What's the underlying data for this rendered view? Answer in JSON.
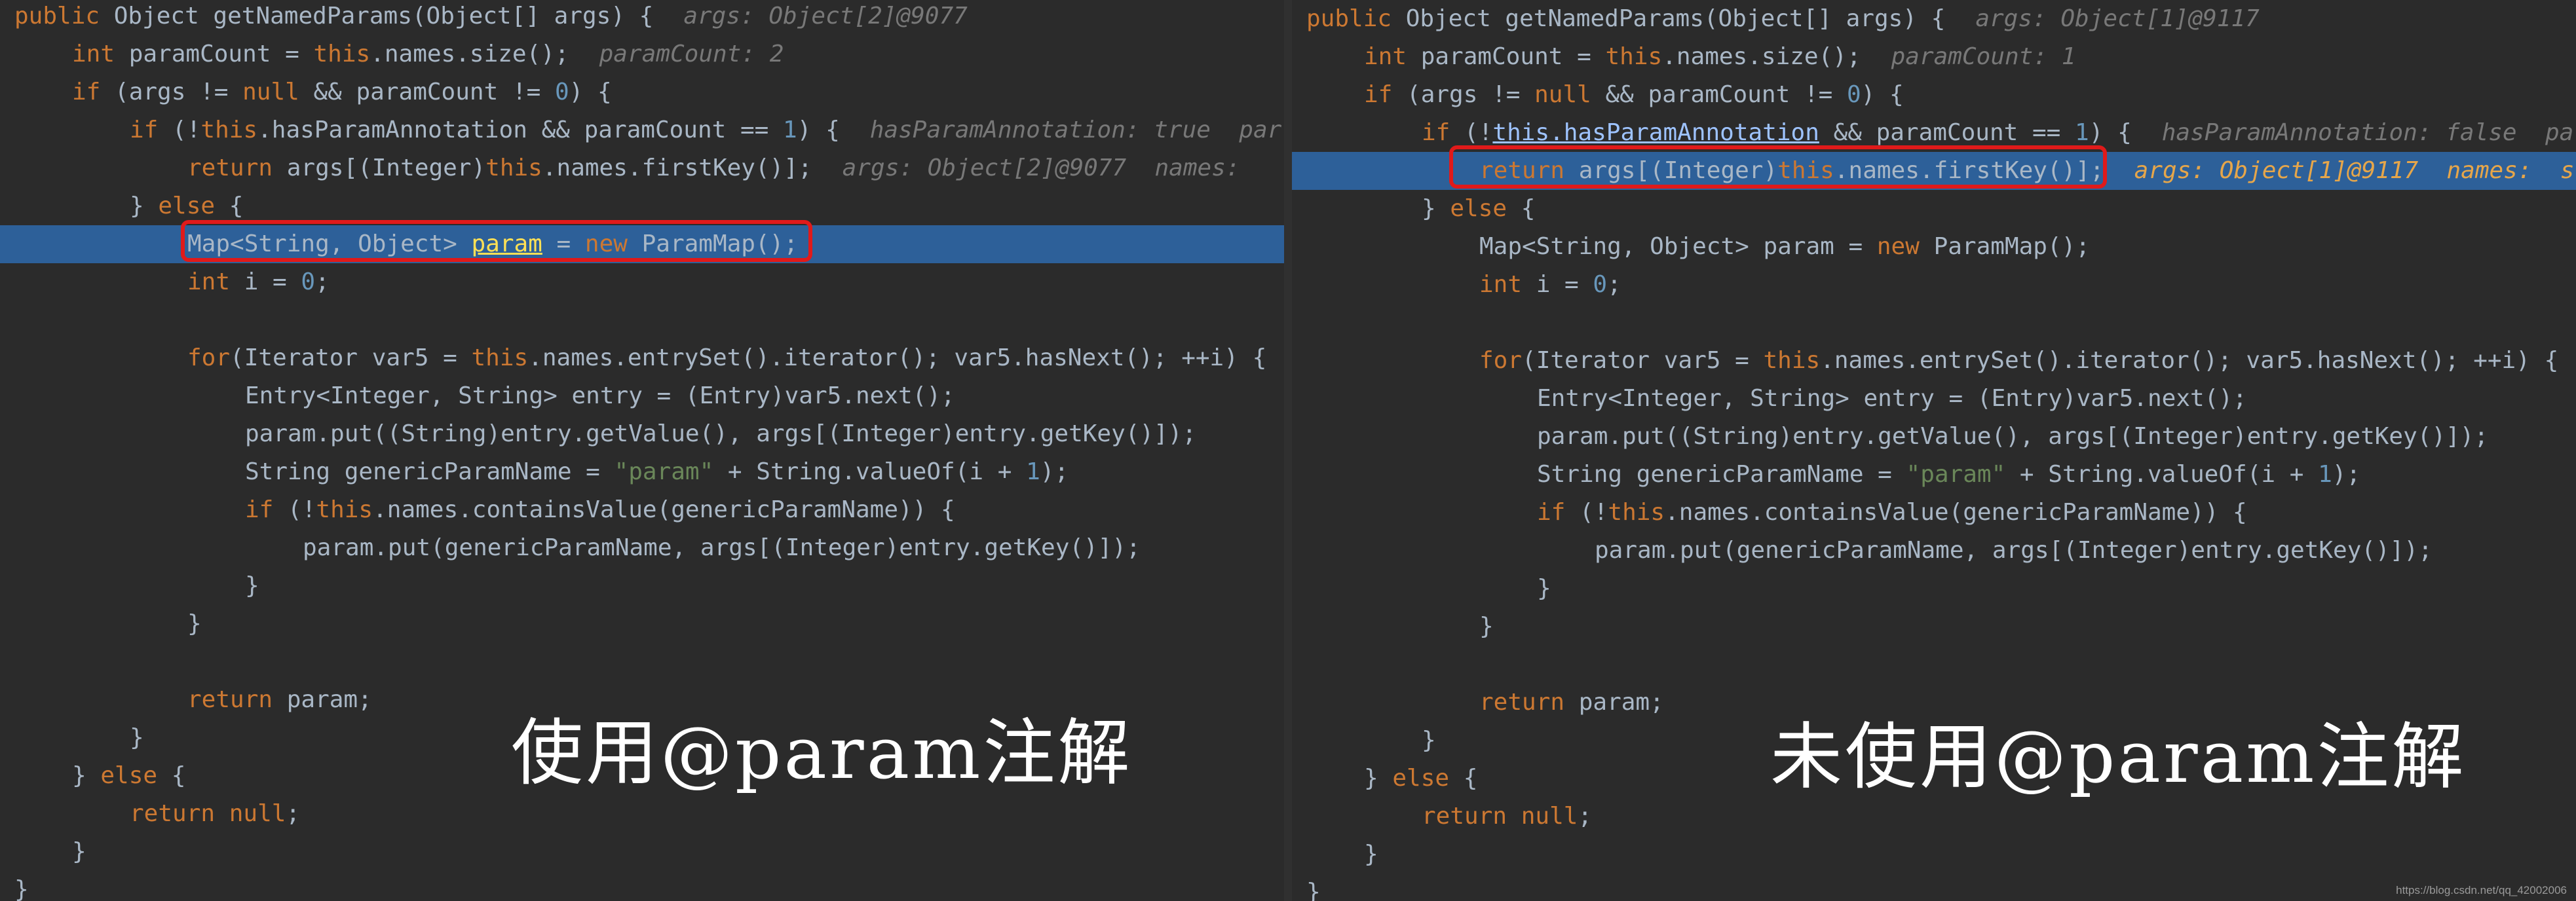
{
  "left": {
    "lines": [
      {
        "indent": 0,
        "parts": [
          [
            "kw",
            "public "
          ],
          [
            "p",
            "Object getNamedParams(Object[] args) {"
          ],
          [
            "hint",
            "args: Object[2]@9077"
          ]
        ]
      },
      {
        "indent": 1,
        "parts": [
          [
            "kw",
            "int "
          ],
          [
            "p",
            "paramCount = "
          ],
          [
            "this",
            "this"
          ],
          [
            "p",
            ".names.size();"
          ],
          [
            "hint",
            "paramCount: 2"
          ]
        ]
      },
      {
        "indent": 1,
        "parts": [
          [
            "kw",
            "if "
          ],
          [
            "p",
            "(args != "
          ],
          [
            "kw",
            "null "
          ],
          [
            "p",
            "&& paramCount != "
          ],
          [
            "num",
            "0"
          ],
          [
            "p",
            ") {"
          ]
        ]
      },
      {
        "indent": 2,
        "parts": [
          [
            "kw",
            "if "
          ],
          [
            "p",
            "(!"
          ],
          [
            "this",
            "this"
          ],
          [
            "p",
            ".hasParamAnnotation && paramCount == "
          ],
          [
            "num",
            "1"
          ],
          [
            "p",
            ") {"
          ],
          [
            "hint",
            "hasParamAnnotation: true  par"
          ]
        ]
      },
      {
        "indent": 3,
        "parts": [
          [
            "kw",
            "return "
          ],
          [
            "p",
            "args[(Integer)"
          ],
          [
            "this",
            "this"
          ],
          [
            "p",
            ".names.firstKey()];"
          ],
          [
            "hint",
            "args: Object[2]@9077  names: "
          ]
        ]
      },
      {
        "indent": 2,
        "parts": [
          [
            "p",
            "} "
          ],
          [
            "kw",
            "else "
          ],
          [
            "p",
            "{"
          ]
        ]
      },
      {
        "indent": 3,
        "hl": true,
        "parts": [
          [
            "p",
            "Map<String, Object> "
          ],
          [
            "uly",
            "param"
          ],
          [
            "p",
            " = "
          ],
          [
            "kw",
            "new "
          ],
          [
            "p",
            "ParamMap();"
          ]
        ]
      },
      {
        "indent": 3,
        "parts": [
          [
            "kw",
            "int "
          ],
          [
            "p",
            "i = "
          ],
          [
            "num",
            "0"
          ],
          [
            "p",
            ";"
          ]
        ]
      },
      {
        "indent": 0,
        "parts": []
      },
      {
        "indent": 3,
        "parts": [
          [
            "kw",
            "for"
          ],
          [
            "p",
            "(Iterator var5 = "
          ],
          [
            "this",
            "this"
          ],
          [
            "p",
            ".names.entrySet().iterator(); var5.hasNext(); ++i) {"
          ]
        ]
      },
      {
        "indent": 4,
        "parts": [
          [
            "p",
            "Entry<Integer, String> entry = (Entry)var5.next();"
          ]
        ]
      },
      {
        "indent": 4,
        "parts": [
          [
            "p",
            "param.put((String)entry.getValue(), args[(Integer)entry.getKey()]);"
          ]
        ]
      },
      {
        "indent": 4,
        "parts": [
          [
            "p",
            "String genericParamName = "
          ],
          [
            "str",
            "\"param\""
          ],
          [
            "p",
            " + String.valueOf(i + "
          ],
          [
            "num",
            "1"
          ],
          [
            "p",
            ");"
          ]
        ]
      },
      {
        "indent": 4,
        "parts": [
          [
            "kw",
            "if "
          ],
          [
            "p",
            "(!"
          ],
          [
            "this",
            "this"
          ],
          [
            "p",
            ".names.containsValue(genericParamName)) {"
          ]
        ]
      },
      {
        "indent": 5,
        "parts": [
          [
            "p",
            "param.put(genericParamName, args[(Integer)entry.getKey()]);"
          ]
        ]
      },
      {
        "indent": 4,
        "parts": [
          [
            "p",
            "}"
          ]
        ]
      },
      {
        "indent": 3,
        "parts": [
          [
            "p",
            "}"
          ]
        ]
      },
      {
        "indent": 0,
        "parts": []
      },
      {
        "indent": 3,
        "parts": [
          [
            "kw",
            "return "
          ],
          [
            "p",
            "param;"
          ]
        ]
      },
      {
        "indent": 2,
        "parts": [
          [
            "p",
            "}"
          ]
        ]
      },
      {
        "indent": 1,
        "parts": [
          [
            "p",
            "} "
          ],
          [
            "kw",
            "else "
          ],
          [
            "p",
            "{"
          ]
        ]
      },
      {
        "indent": 2,
        "parts": [
          [
            "kw",
            "return null"
          ],
          [
            "p",
            ";"
          ]
        ]
      },
      {
        "indent": 1,
        "parts": [
          [
            "p",
            "}"
          ]
        ]
      },
      {
        "indent": 0,
        "parts": [
          [
            "p",
            "}"
          ]
        ]
      }
    ],
    "caption": "使用@param注解"
  },
  "right": {
    "lines": [
      {
        "indent": 0,
        "parts": [
          [
            "kw",
            "public "
          ],
          [
            "p",
            "Object getNamedParams(Object[] args) {"
          ],
          [
            "hint",
            "args: Object[1]@9117"
          ]
        ]
      },
      {
        "indent": 1,
        "parts": [
          [
            "kw",
            "int "
          ],
          [
            "p",
            "paramCount = "
          ],
          [
            "this",
            "this"
          ],
          [
            "p",
            ".names.size();"
          ],
          [
            "hint",
            "paramCount: 1"
          ]
        ]
      },
      {
        "indent": 1,
        "parts": [
          [
            "kw",
            "if "
          ],
          [
            "p",
            "(args != "
          ],
          [
            "kw",
            "null "
          ],
          [
            "p",
            "&& paramCount != "
          ],
          [
            "num",
            "0"
          ],
          [
            "p",
            ") {"
          ]
        ]
      },
      {
        "indent": 2,
        "parts": [
          [
            "kw",
            "if "
          ],
          [
            "p",
            "(!"
          ],
          [
            "ulb",
            "this.hasParamAnnotation"
          ],
          [
            "p",
            " && paramCount == "
          ],
          [
            "num",
            "1"
          ],
          [
            "p",
            ") {"
          ],
          [
            "hint",
            "hasParamAnnotation: false  pa"
          ]
        ]
      },
      {
        "indent": 3,
        "hl": true,
        "parts": [
          [
            "kw",
            "return "
          ],
          [
            "p",
            "args[(Integer)"
          ],
          [
            "this",
            "this"
          ],
          [
            "p",
            ".names.firstKey()];"
          ],
          [
            "hinto",
            "args: Object[1]@9117  names:  s"
          ]
        ]
      },
      {
        "indent": 2,
        "parts": [
          [
            "p",
            "} "
          ],
          [
            "kw",
            "else "
          ],
          [
            "p",
            "{"
          ]
        ]
      },
      {
        "indent": 3,
        "parts": [
          [
            "p",
            "Map<String, Object> param = "
          ],
          [
            "kw",
            "new "
          ],
          [
            "p",
            "ParamMap();"
          ]
        ]
      },
      {
        "indent": 3,
        "parts": [
          [
            "kw",
            "int "
          ],
          [
            "p",
            "i = "
          ],
          [
            "num",
            "0"
          ],
          [
            "p",
            ";"
          ]
        ]
      },
      {
        "indent": 0,
        "parts": []
      },
      {
        "indent": 3,
        "parts": [
          [
            "kw",
            "for"
          ],
          [
            "p",
            "(Iterator var5 = "
          ],
          [
            "this",
            "this"
          ],
          [
            "p",
            ".names.entrySet().iterator(); var5.hasNext(); ++i) {"
          ]
        ]
      },
      {
        "indent": 4,
        "parts": [
          [
            "p",
            "Entry<Integer, String> entry = (Entry)var5.next();"
          ]
        ]
      },
      {
        "indent": 4,
        "parts": [
          [
            "p",
            "param.put((String)entry.getValue(), args[(Integer)entry.getKey()]);"
          ]
        ]
      },
      {
        "indent": 4,
        "parts": [
          [
            "p",
            "String genericParamName = "
          ],
          [
            "str",
            "\"param\""
          ],
          [
            "p",
            " + String.valueOf(i + "
          ],
          [
            "num",
            "1"
          ],
          [
            "p",
            ");"
          ]
        ]
      },
      {
        "indent": 4,
        "parts": [
          [
            "kw",
            "if "
          ],
          [
            "p",
            "(!"
          ],
          [
            "this",
            "this"
          ],
          [
            "p",
            ".names.containsValue(genericParamName)) {"
          ]
        ]
      },
      {
        "indent": 5,
        "parts": [
          [
            "p",
            "param.put(genericParamName, args[(Integer)entry.getKey()]);"
          ]
        ]
      },
      {
        "indent": 4,
        "parts": [
          [
            "p",
            "}"
          ]
        ]
      },
      {
        "indent": 3,
        "parts": [
          [
            "p",
            "}"
          ]
        ]
      },
      {
        "indent": 0,
        "parts": []
      },
      {
        "indent": 3,
        "parts": [
          [
            "kw",
            "return "
          ],
          [
            "p",
            "param;"
          ]
        ]
      },
      {
        "indent": 2,
        "parts": [
          [
            "p",
            "}"
          ]
        ]
      },
      {
        "indent": 1,
        "parts": [
          [
            "p",
            "} "
          ],
          [
            "kw",
            "else "
          ],
          [
            "p",
            "{"
          ]
        ]
      },
      {
        "indent": 2,
        "parts": [
          [
            "kw",
            "return null"
          ],
          [
            "p",
            ";"
          ]
        ]
      },
      {
        "indent": 1,
        "parts": [
          [
            "p",
            "}"
          ]
        ]
      },
      {
        "indent": 0,
        "parts": [
          [
            "p",
            "}"
          ]
        ]
      }
    ],
    "caption": "未使用@param注解"
  },
  "watermark": "https://blog.csdn.net/qq_42002006",
  "colors": {
    "background": "#2b2b2b",
    "keyword": "#cc7832",
    "number": "#6897bb",
    "string": "#6a8759",
    "text": "#a9b7c6",
    "highlight": "#2d6099",
    "annotation_box": "#e01a1a"
  }
}
